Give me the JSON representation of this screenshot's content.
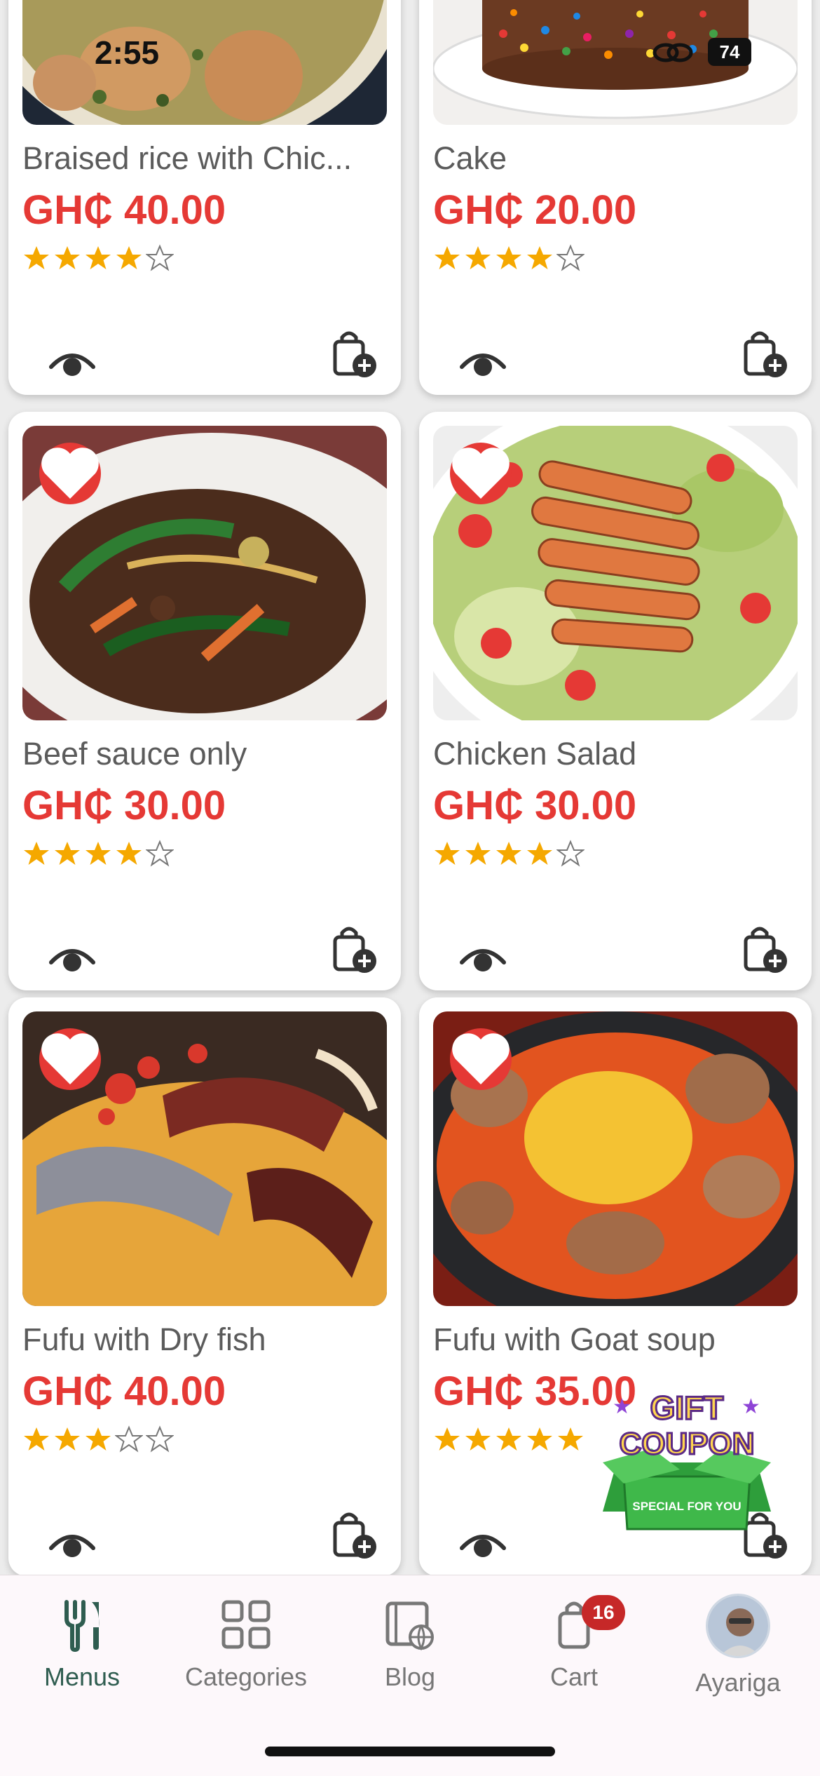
{
  "status_bar": {
    "time": "2:55",
    "battery": "74"
  },
  "currency": "GH₵",
  "menu_items": [
    {
      "name": "Braised rice with Chic...",
      "price": "GH₵ 40.00",
      "rating": 4,
      "max_rating": 5,
      "favorite": false
    },
    {
      "name": "Cake",
      "price": "GH₵ 20.00",
      "rating": 4,
      "max_rating": 5,
      "favorite": false
    },
    {
      "name": "Beef sauce only",
      "price": "GH₵ 30.00",
      "rating": 4,
      "max_rating": 5,
      "favorite": true
    },
    {
      "name": "Chicken Salad",
      "price": "GH₵ 30.00",
      "rating": 4,
      "max_rating": 5,
      "favorite": true
    },
    {
      "name": "Fufu with Dry fish",
      "price": "GH₵ 40.00",
      "rating": 3,
      "max_rating": 5,
      "favorite": true
    },
    {
      "name": "Fufu with Goat soup",
      "price": "GH₵ 35.00",
      "rating": 5,
      "max_rating": 5,
      "favorite": true
    }
  ],
  "coupon": {
    "line1": "GIFT",
    "line2": "COUPON",
    "tagline": "SPECIAL FOR YOU"
  },
  "bottom_nav": {
    "menus": "Menus",
    "categories": "Categories",
    "blog": "Blog",
    "cart": "Cart",
    "cart_count": "16",
    "profile": "Ayariga"
  },
  "colors": {
    "price": "#e53935",
    "star": "#f5a800",
    "favorite_bg": "#e53935",
    "active_nav": "#2f5d50",
    "badge": "#c62828"
  },
  "icons": {
    "view": "eye-icon",
    "add_to_cart": "bag-plus-icon",
    "favorite": "heart-icon",
    "menus": "fork-knife-icon",
    "categories": "grid-icon",
    "blog": "book-globe-icon",
    "cart": "shopping-bag-icon"
  }
}
